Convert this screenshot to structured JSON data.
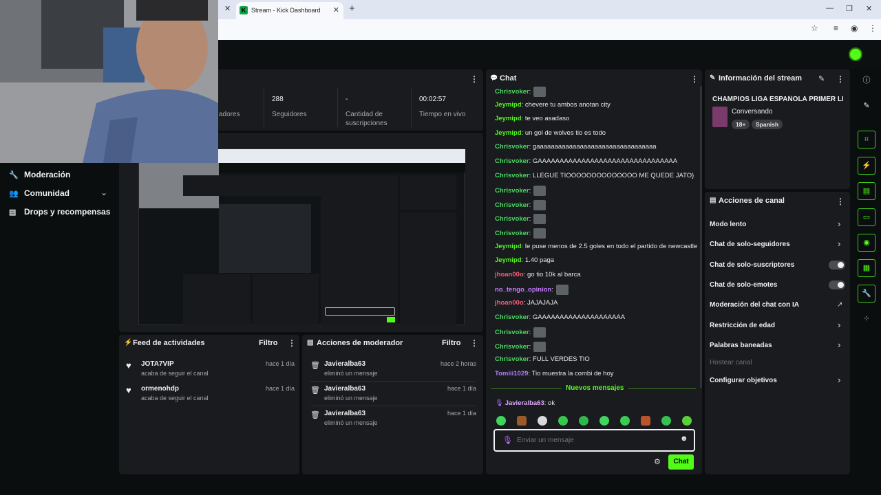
{
  "browser": {
    "tab_title": "Stream - Kick Dashboard",
    "tab_close": "✕",
    "new_tab": "+"
  },
  "nav": {
    "items": [
      {
        "label": "Moderación",
        "icon": "wrench-icon"
      },
      {
        "label": "Comunidad",
        "icon": "users-icon"
      },
      {
        "label": "Drops y recompensas",
        "icon": "gift-icon"
      }
    ]
  },
  "stats": {
    "items": [
      {
        "value": "",
        "label": "adores"
      },
      {
        "value": "288",
        "label": "Seguidores"
      },
      {
        "value": "-",
        "label": "Cantidad de suscripciones"
      },
      {
        "value": "00:02:57",
        "label": "Tiempo en vivo"
      }
    ]
  },
  "activity_feed": {
    "title": "Feed de actividades",
    "filter": "Filtro",
    "items": [
      {
        "name": "JOTA7VIP",
        "desc": "acaba de seguir el canal",
        "time": "hace 1 día"
      },
      {
        "name": "ormenohdp",
        "desc": "acaba de seguir el canal",
        "time": "hace 1 día"
      }
    ]
  },
  "mod_actions": {
    "title": "Acciones de moderador",
    "filter": "Filtro",
    "items": [
      {
        "name": "Javieralba63",
        "desc": "eliminó un mensaje",
        "time": "hace 2 horas"
      },
      {
        "name": "Javieralba63",
        "desc": "eliminó un mensaje",
        "time": "hace 1 día"
      },
      {
        "name": "Javieralba63",
        "desc": "eliminó un mensaje",
        "time": "hace 1 día"
      }
    ]
  },
  "chat": {
    "title": "Chat",
    "messages": [
      {
        "user": "Chrisvoker",
        "color": "#4cd964",
        "text": "",
        "emotes": 1
      },
      {
        "user": "Jeymipd",
        "color": "#53fc18",
        "text": "chevere tu ambos anotan city",
        "emotes": 0
      },
      {
        "user": "Jeymipd",
        "color": "#53fc18",
        "text": "te veo asadaso",
        "emotes": 0
      },
      {
        "user": "Jeymipd",
        "color": "#53fc18",
        "text": "un gol de wolves tio es todo",
        "emotes": 0
      },
      {
        "user": "Chrisvoker",
        "color": "#4cd964",
        "text": "gaaaaaaaaaaaaaaaaaaaaaaaaaaaaaaaaa",
        "emotes": 0
      },
      {
        "user": "Chrisvoker",
        "color": "#4cd964",
        "text": "GAAAAAAAAAAAAAAAAAAAAAAAAAAAAAAAA",
        "emotes": 0
      },
      {
        "user": "Chrisvoker",
        "color": "#4cd964",
        "text": "LLEGUE TIOOOOOOOOOOOOOO ME QUEDE JATO}",
        "emotes": 0
      },
      {
        "user": "Chrisvoker",
        "color": "#4cd964",
        "text": "",
        "emotes": 1
      },
      {
        "user": "Chrisvoker",
        "color": "#4cd964",
        "text": "",
        "emotes": 1
      },
      {
        "user": "Chrisvoker",
        "color": "#4cd964",
        "text": "",
        "emotes": 1
      },
      {
        "user": "Chrisvoker",
        "color": "#4cd964",
        "text": "",
        "emotes": 1
      },
      {
        "user": "Jeymipd",
        "color": "#53fc18",
        "text": "le puse menos de 2.5 goles en todo el partido de newcastle",
        "emotes": 0
      },
      {
        "user": "Jeymipd",
        "color": "#53fc18",
        "text": "1.40 paga",
        "emotes": 0
      },
      {
        "user": "jhoan00o",
        "color": "#ff5a7a",
        "text": "go tio 10k al barca",
        "emotes": 0
      },
      {
        "user": "no_tengo_opinion",
        "color": "#c77dff",
        "text": "",
        "emotes": 1
      },
      {
        "user": "jhoan00o",
        "color": "#ff5a7a",
        "text": "JAJAJAJA",
        "emotes": 0
      },
      {
        "user": "Chrisvoker",
        "color": "#4cd964",
        "text": "GAAAAAAAAAAAAAAAAAAAA",
        "emotes": 0
      },
      {
        "user": "Chrisvoker",
        "color": "#4cd964",
        "text": "",
        "emotes": 1
      },
      {
        "user": "Chrisvoker",
        "color": "#4cd964",
        "text": "",
        "emotes": 1
      },
      {
        "user": "Chrisvoker",
        "color": "#4cd964",
        "text": "FULL VERDES TIO",
        "emotes": 0
      },
      {
        "user": "Tomiii1029",
        "color": "#b57bff",
        "text": "Tio muestra la combi de hoy",
        "emotes": 0
      }
    ],
    "new_messages": "Nuevos mensajes",
    "pinned": {
      "user": "Javieralba63",
      "color": "#e0a8ff",
      "text": "ok"
    },
    "input_placeholder": "Enviar un mensaje",
    "send_label": "Chat"
  },
  "stream_info": {
    "title": "Información del stream",
    "stream_title": "CHAMPIOS LIGA ESPAÑOLA PRIMER LIGE",
    "category": "Conversando",
    "tags": [
      "18+",
      "Spanish"
    ]
  },
  "channel_actions": {
    "title": "Acciones de canal",
    "items": [
      {
        "label": "Modo lento",
        "control": "chevron"
      },
      {
        "label": "Chat de solo-seguidores",
        "control": "chevron"
      },
      {
        "label": "Chat de solo-suscriptores",
        "control": "toggle"
      },
      {
        "label": "Chat de solo-emotes",
        "control": "toggle"
      },
      {
        "label": "Moderación del chat con IA",
        "control": "external"
      },
      {
        "label": "Restricción de edad",
        "control": "chevron"
      },
      {
        "label": "Palabras baneadas",
        "control": "chevron"
      },
      {
        "label": "Hostear canal",
        "control": "none"
      },
      {
        "label": "Configurar objetivos",
        "control": "chevron"
      }
    ]
  },
  "colors": {
    "accent": "#53fc18",
    "panel": "#191b1f",
    "bg": "#0b0e0f"
  }
}
